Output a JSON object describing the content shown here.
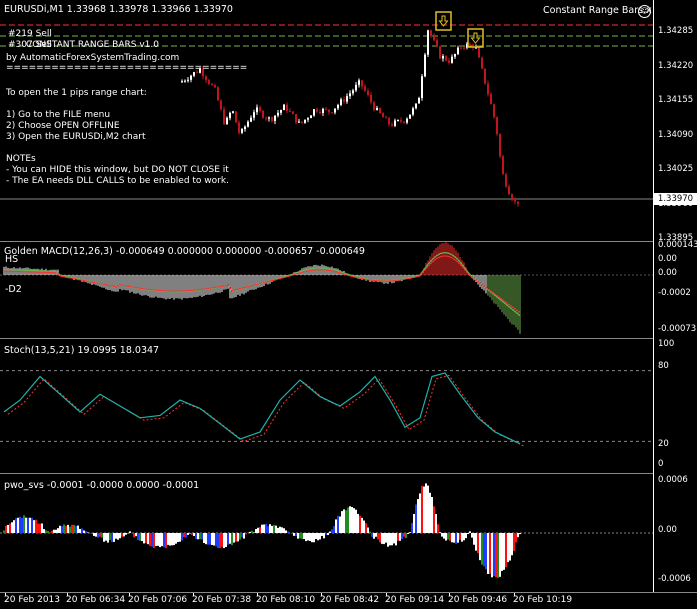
{
  "main": {
    "header": "EURUSDi,M1  1.33968 1.33978 1.33966 1.33970",
    "indicator_name": "Constant Range Bars.x",
    "info_lines": [
      "#219 Sell",
      "#307 Sell",
      "CONSTANT RANGE BARS v1.0",
      "by AutomaticForexSystemTrading.com",
      "================================",
      "",
      "To open the 1 pips range chart:",
      "",
      "1) Go to the FILE menu",
      "2) Choose OPEN OFFLINE",
      "3) Open the EURUSDi,M2 chart",
      "",
      "NOTEs",
      " - You can HIDE this window, but DO NOT CLOSE it",
      " - The EA needs DLL CALLS to be enabled to work."
    ],
    "price_labels": [
      "1.34285",
      "1.34220",
      "1.34155",
      "1.34090",
      "1.34025",
      "1.33960",
      "1.33895"
    ],
    "price_values": [
      1.34285,
      1.3422,
      1.34155,
      1.3409,
      1.34025,
      1.3396,
      1.33895
    ],
    "current_price": "1.33970",
    "trade_arrows": [
      "sell-arrow-1",
      "sell-arrow-2"
    ]
  },
  "macd": {
    "title": "Golden MACD(12,26,3) -0.000649 0.000000 0.000000 -0.000657 -0.000649",
    "left_labels": [
      "HS",
      "-D2"
    ],
    "axis_labels": [
      "0.000143",
      "0.00",
      "0.00",
      "-0.0002",
      "-0.00073"
    ]
  },
  "stoch": {
    "title": "Stoch(13,5,21) 19.0995 18.0347",
    "axis_labels": [
      "100",
      "80",
      "20",
      "0"
    ]
  },
  "pwo": {
    "title": "pwo_svs -0.0001 -0.0000 0.0000 -0.0001",
    "axis_labels": [
      "0.0006",
      "0.00",
      "-0.0006"
    ]
  },
  "time_axis": [
    "20 Feb 2013",
    "20 Feb 06:34",
    "20 Feb 07:06",
    "20 Feb 07:38",
    "20 Feb 08:10",
    "20 Feb 08:42",
    "20 Feb 09:14",
    "20 Feb 09:46",
    "20 Feb 10:19"
  ],
  "colors": {
    "bull": "#ffffff",
    "bear": "#c0141e",
    "grid": "#888888",
    "sell_line": "#ff3030",
    "green_line": "#7cb342",
    "macd_green": "#6ab04c",
    "macd_red": "#ff3030",
    "stoch_main": "#20b2aa",
    "stoch_signal": "#ff3030",
    "pwo_blue": "#1e3cff",
    "pwo_green": "#1e8c1e",
    "pwo_red": "#ff1010",
    "pwo_white": "#ffffff"
  }
}
